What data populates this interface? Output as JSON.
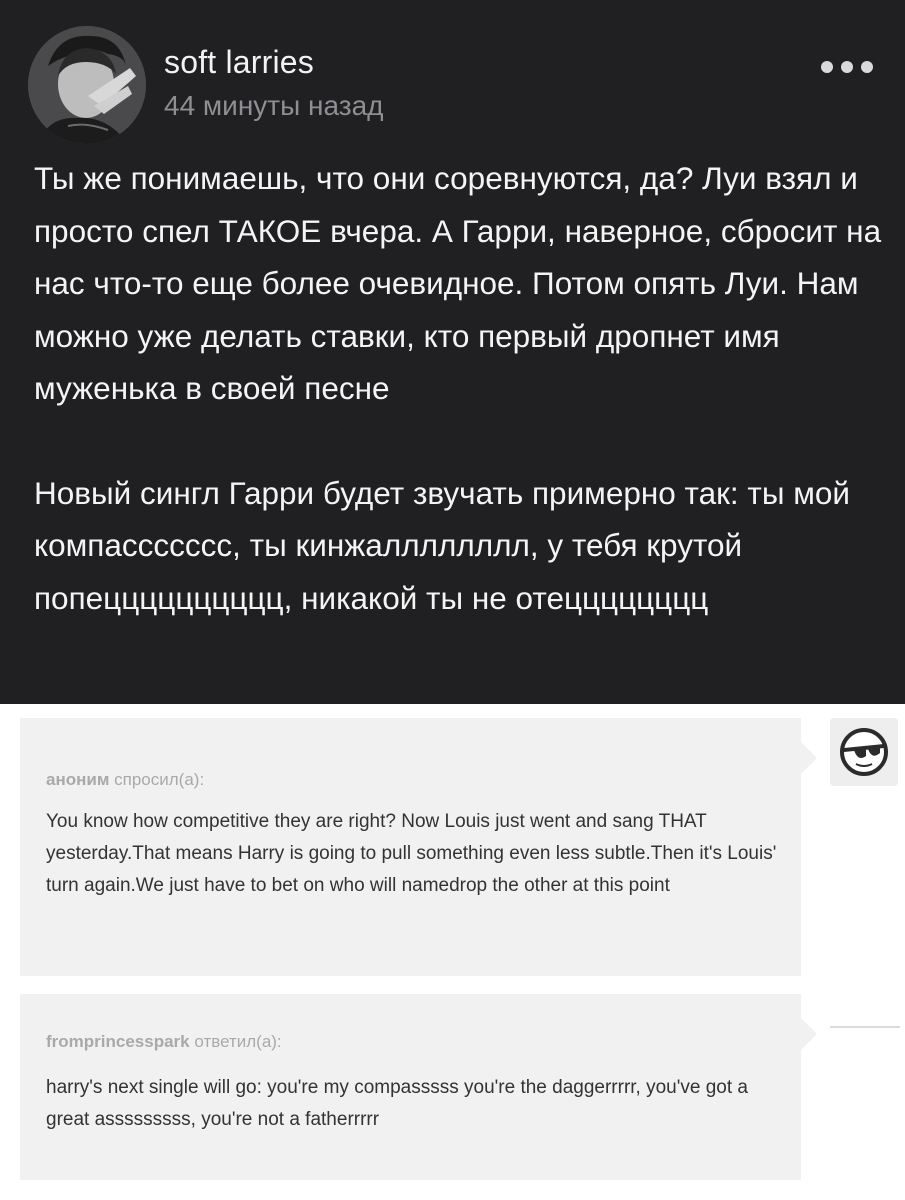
{
  "post": {
    "author": "soft larries",
    "time": "44 минуты назад",
    "paragraphs": [
      "Ты же понимаешь, что они соревнуются, да? Луи взял и просто спел ТАКОЕ вчера. А Гарри, наверное, сбросит на нас что-то еще более очевидное. Потом опять Луи. Нам можно уже делать ставки, кто первый дропнет имя муженька в своей песне",
      "Новый сингл Гарри будет звучать примерно так: ты мой компассссссс, ты кинжалллллллл, у тебя крутой попецццццццццц, никакой ты не отецццццццц"
    ],
    "menu_icon": "more-dots-icon"
  },
  "ask": {
    "asker": "аноним",
    "asked_label": "спросил(а):",
    "question": "You know how competitive they are right? Now Louis just went and sang THAT yesterday.That means Harry is going to pull something even less subtle.Then it's Louis' turn again.We just have to bet on who will namedrop the other at this point",
    "anon_icon": "anonymous-sunglasses-icon"
  },
  "answer": {
    "responder": "fromprincesspark",
    "answered_label": "ответил(а):",
    "text": "harry's next single will go: you're my compasssss you're the daggerrrrr, you've got a great asssssssss, you're not a fatherrrrr"
  },
  "colors": {
    "post_bg": "#202022",
    "post_text": "#f4f4f4",
    "muted_text": "#8e8e93",
    "bubble_bg": "#f1f1f1"
  }
}
